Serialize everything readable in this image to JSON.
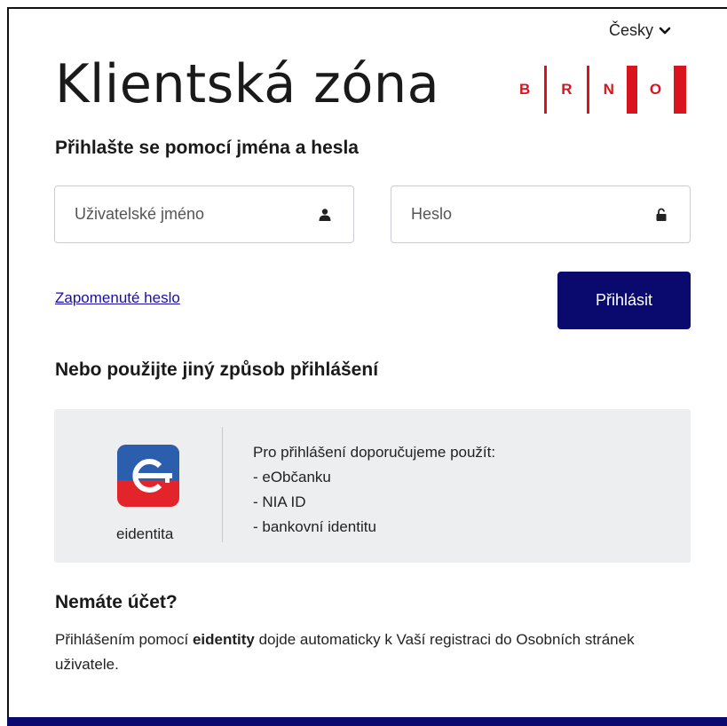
{
  "language": {
    "selected": "Česky"
  },
  "header": {
    "title": "Klientská zóna",
    "logo_letters": [
      "B",
      "R",
      "N",
      "O"
    ]
  },
  "login": {
    "subtitle": "Přihlašte se pomocí jména a hesla",
    "username_placeholder": "Uživatelské jméno",
    "password_placeholder": "Heslo",
    "forgot_link": "Zapomenuté heslo",
    "submit_label": "Přihlásit"
  },
  "alternative": {
    "title": "Nebo použijte jiný způsob přihlášení",
    "eid_label": "eidentita",
    "recommend_heading": "Pro přihlášení doporučujeme použít:",
    "options": [
      "- eObčanku",
      "- NIA ID",
      "- bankovní identitu"
    ]
  },
  "no_account": {
    "title": "Nemáte účet?",
    "text_before": "Přihlášením pomocí ",
    "text_bold": "eidentity",
    "text_after": " dojde automaticky k Vaší registraci do Osobních stránek uživatele."
  },
  "colors": {
    "brand_red": "#d9141e",
    "primary_navy": "#0a0a6e",
    "link_blue": "#1a0dab"
  }
}
